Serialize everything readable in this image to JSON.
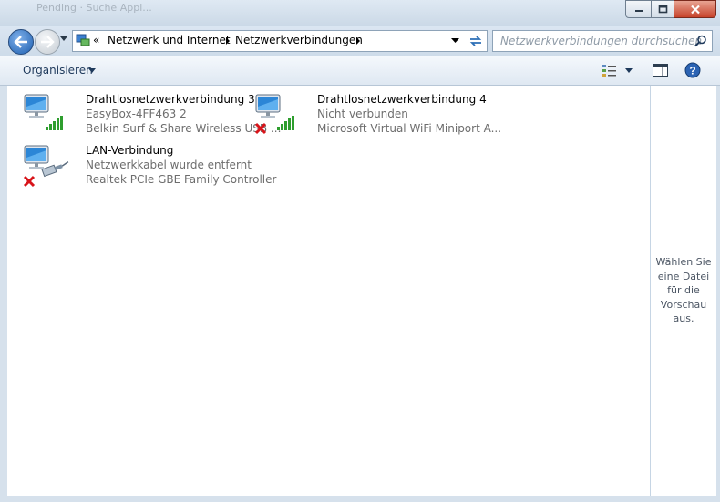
{
  "window": {
    "ghost_title": "Pending · Suche Appl...",
    "controls": {
      "minimize": "–",
      "maximize": "□",
      "close": "✕"
    }
  },
  "nav": {
    "breadcrumb_prefix": "«",
    "breadcrumb": [
      "Netzwerk und Internet",
      "Netzwerkverbindungen"
    ],
    "search_placeholder": "Netzwerkverbindungen durchsuchen"
  },
  "toolbar": {
    "organize_label": "Organisieren"
  },
  "connections": [
    {
      "name": "Drahtlosnetzwerkverbindung 3",
      "status": "EasyBox-4FF463  2",
      "device": "Belkin Surf & Share Wireless USB ...",
      "type": "wireless",
      "disconnected": false
    },
    {
      "name": "Drahtlosnetzwerkverbindung 4",
      "status": "Nicht verbunden",
      "device": "Microsoft Virtual WiFi Miniport A...",
      "type": "wireless",
      "disconnected": true
    },
    {
      "name": "LAN-Verbindung",
      "status": "Netzwerkkabel wurde entfernt",
      "device": "Realtek PCIe GBE Family Controller",
      "type": "wired",
      "disconnected": true
    }
  ],
  "preview": {
    "lines": [
      "Wählen Sie",
      "eine Datei",
      "für die",
      "Vorschau",
      "aus."
    ]
  },
  "colors": {
    "signal": "#2e9e2e",
    "error": "#d8141a",
    "accent": "#1e395b"
  }
}
